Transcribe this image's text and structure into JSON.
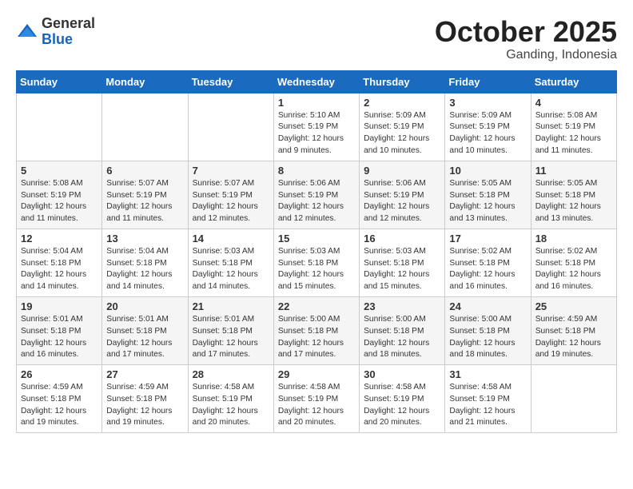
{
  "header": {
    "logo_line1": "General",
    "logo_line2": "Blue",
    "month": "October 2025",
    "location": "Ganding, Indonesia"
  },
  "weekdays": [
    "Sunday",
    "Monday",
    "Tuesday",
    "Wednesday",
    "Thursday",
    "Friday",
    "Saturday"
  ],
  "weeks": [
    [
      {
        "day": "",
        "info": ""
      },
      {
        "day": "",
        "info": ""
      },
      {
        "day": "",
        "info": ""
      },
      {
        "day": "1",
        "info": "Sunrise: 5:10 AM\nSunset: 5:19 PM\nDaylight: 12 hours\nand 9 minutes."
      },
      {
        "day": "2",
        "info": "Sunrise: 5:09 AM\nSunset: 5:19 PM\nDaylight: 12 hours\nand 10 minutes."
      },
      {
        "day": "3",
        "info": "Sunrise: 5:09 AM\nSunset: 5:19 PM\nDaylight: 12 hours\nand 10 minutes."
      },
      {
        "day": "4",
        "info": "Sunrise: 5:08 AM\nSunset: 5:19 PM\nDaylight: 12 hours\nand 11 minutes."
      }
    ],
    [
      {
        "day": "5",
        "info": "Sunrise: 5:08 AM\nSunset: 5:19 PM\nDaylight: 12 hours\nand 11 minutes."
      },
      {
        "day": "6",
        "info": "Sunrise: 5:07 AM\nSunset: 5:19 PM\nDaylight: 12 hours\nand 11 minutes."
      },
      {
        "day": "7",
        "info": "Sunrise: 5:07 AM\nSunset: 5:19 PM\nDaylight: 12 hours\nand 12 minutes."
      },
      {
        "day": "8",
        "info": "Sunrise: 5:06 AM\nSunset: 5:19 PM\nDaylight: 12 hours\nand 12 minutes."
      },
      {
        "day": "9",
        "info": "Sunrise: 5:06 AM\nSunset: 5:19 PM\nDaylight: 12 hours\nand 12 minutes."
      },
      {
        "day": "10",
        "info": "Sunrise: 5:05 AM\nSunset: 5:18 PM\nDaylight: 12 hours\nand 13 minutes."
      },
      {
        "day": "11",
        "info": "Sunrise: 5:05 AM\nSunset: 5:18 PM\nDaylight: 12 hours\nand 13 minutes."
      }
    ],
    [
      {
        "day": "12",
        "info": "Sunrise: 5:04 AM\nSunset: 5:18 PM\nDaylight: 12 hours\nand 14 minutes."
      },
      {
        "day": "13",
        "info": "Sunrise: 5:04 AM\nSunset: 5:18 PM\nDaylight: 12 hours\nand 14 minutes."
      },
      {
        "day": "14",
        "info": "Sunrise: 5:03 AM\nSunset: 5:18 PM\nDaylight: 12 hours\nand 14 minutes."
      },
      {
        "day": "15",
        "info": "Sunrise: 5:03 AM\nSunset: 5:18 PM\nDaylight: 12 hours\nand 15 minutes."
      },
      {
        "day": "16",
        "info": "Sunrise: 5:03 AM\nSunset: 5:18 PM\nDaylight: 12 hours\nand 15 minutes."
      },
      {
        "day": "17",
        "info": "Sunrise: 5:02 AM\nSunset: 5:18 PM\nDaylight: 12 hours\nand 16 minutes."
      },
      {
        "day": "18",
        "info": "Sunrise: 5:02 AM\nSunset: 5:18 PM\nDaylight: 12 hours\nand 16 minutes."
      }
    ],
    [
      {
        "day": "19",
        "info": "Sunrise: 5:01 AM\nSunset: 5:18 PM\nDaylight: 12 hours\nand 16 minutes."
      },
      {
        "day": "20",
        "info": "Sunrise: 5:01 AM\nSunset: 5:18 PM\nDaylight: 12 hours\nand 17 minutes."
      },
      {
        "day": "21",
        "info": "Sunrise: 5:01 AM\nSunset: 5:18 PM\nDaylight: 12 hours\nand 17 minutes."
      },
      {
        "day": "22",
        "info": "Sunrise: 5:00 AM\nSunset: 5:18 PM\nDaylight: 12 hours\nand 17 minutes."
      },
      {
        "day": "23",
        "info": "Sunrise: 5:00 AM\nSunset: 5:18 PM\nDaylight: 12 hours\nand 18 minutes."
      },
      {
        "day": "24",
        "info": "Sunrise: 5:00 AM\nSunset: 5:18 PM\nDaylight: 12 hours\nand 18 minutes."
      },
      {
        "day": "25",
        "info": "Sunrise: 4:59 AM\nSunset: 5:18 PM\nDaylight: 12 hours\nand 19 minutes."
      }
    ],
    [
      {
        "day": "26",
        "info": "Sunrise: 4:59 AM\nSunset: 5:18 PM\nDaylight: 12 hours\nand 19 minutes."
      },
      {
        "day": "27",
        "info": "Sunrise: 4:59 AM\nSunset: 5:18 PM\nDaylight: 12 hours\nand 19 minutes."
      },
      {
        "day": "28",
        "info": "Sunrise: 4:58 AM\nSunset: 5:19 PM\nDaylight: 12 hours\nand 20 minutes."
      },
      {
        "day": "29",
        "info": "Sunrise: 4:58 AM\nSunset: 5:19 PM\nDaylight: 12 hours\nand 20 minutes."
      },
      {
        "day": "30",
        "info": "Sunrise: 4:58 AM\nSunset: 5:19 PM\nDaylight: 12 hours\nand 20 minutes."
      },
      {
        "day": "31",
        "info": "Sunrise: 4:58 AM\nSunset: 5:19 PM\nDaylight: 12 hours\nand 21 minutes."
      },
      {
        "day": "",
        "info": ""
      }
    ]
  ]
}
